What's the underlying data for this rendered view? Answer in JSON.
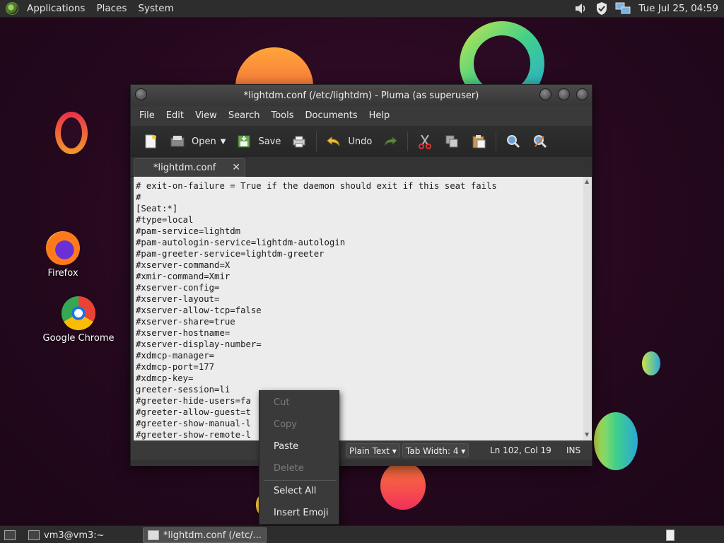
{
  "top_panel": {
    "menus": [
      "Applications",
      "Places",
      "System"
    ],
    "clock": "Tue Jul 25, 04:59"
  },
  "desktop": {
    "icons": [
      {
        "label": "Firefox"
      },
      {
        "label": "Google Chrome"
      }
    ]
  },
  "window": {
    "title": "*lightdm.conf (/etc/lightdm) - Pluma (as superuser)",
    "menus": [
      "File",
      "Edit",
      "View",
      "Search",
      "Tools",
      "Documents",
      "Help"
    ],
    "toolbar": {
      "open_label": "Open",
      "save_label": "Save",
      "undo_label": "Undo"
    },
    "tab_label": "*lightdm.conf",
    "tab_close": "✕",
    "lines": [
      "# exit-on-failure = True if the daemon should exit if this seat fails",
      "#",
      "[Seat:*]",
      "#type=local",
      "#pam-service=lightdm",
      "#pam-autologin-service=lightdm-autologin",
      "#pam-greeter-service=lightdm-greeter",
      "#xserver-command=X",
      "#xmir-command=Xmir",
      "#xserver-config=",
      "#xserver-layout=",
      "#xserver-allow-tcp=false",
      "#xserver-share=true",
      "#xserver-hostname=",
      "#xserver-display-number=",
      "#xdmcp-manager=",
      "#xdmcp-port=177",
      "#xdmcp-key=",
      "greeter-session=li",
      "#greeter-hide-users=fa",
      "#greeter-allow-guest=t",
      "#greeter-show-manual-l",
      "#greeter-show-remote-l"
    ],
    "status": {
      "language": "Plain Text",
      "tab_width": "Tab Width:  4",
      "position": "Ln 102, Col 19",
      "mode": "INS"
    }
  },
  "context_menu": {
    "items": [
      {
        "label": "Cut",
        "enabled": false
      },
      {
        "label": "Copy",
        "enabled": false
      },
      {
        "label": "Paste",
        "enabled": true
      },
      {
        "label": "Delete",
        "enabled": false
      },
      {
        "label": "Select All",
        "enabled": true
      },
      {
        "label": "Insert Emoji",
        "enabled": true
      }
    ]
  },
  "bottom_panel": {
    "tasks": [
      "vm3@vm3:~",
      "*lightdm.conf (/etc/..."
    ]
  },
  "colors": {
    "panel": "#2d2d2d",
    "editor_bg": "#ececec",
    "desktop_bg": "#2a0a22"
  }
}
